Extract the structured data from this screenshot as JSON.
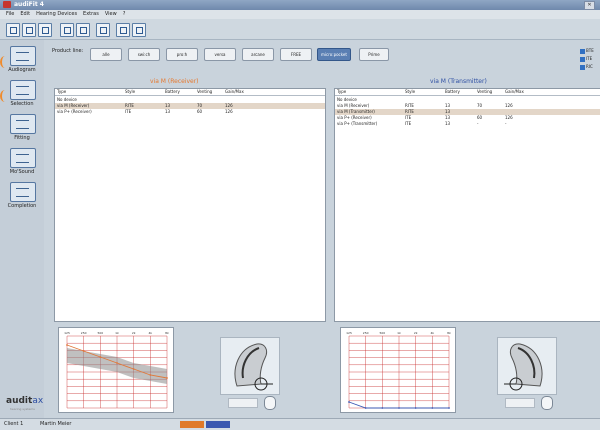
{
  "titlebar": {
    "title": "audiFit 4"
  },
  "menu": [
    "File",
    "Edit",
    "Hearing Devices",
    "Extras",
    "View",
    "?"
  ],
  "toolbar": {
    "icons": [
      "open-icon",
      "back-icon",
      "forward-icon",
      "audiogram-icon",
      "print-icon",
      "help-icon",
      "nav-left-icon",
      "nav-right-icon"
    ]
  },
  "sidebar": {
    "items": [
      {
        "label": "Audiogram",
        "icon": "audiogram-icon"
      },
      {
        "label": "Selection",
        "icon": "selection-icon"
      },
      {
        "label": "Fitting",
        "icon": "fitting-icon"
      },
      {
        "label": "Mo'Sound",
        "icon": "mosound-icon"
      },
      {
        "label": "Completion",
        "icon": "completion-icon"
      }
    ],
    "logo": {
      "brand": "audit",
      "accent": "ax",
      "sub": "hearing systems"
    }
  },
  "product_line": {
    "label": "Product line:",
    "tabs": [
      "alle",
      "swi:ch",
      "pro:h",
      "versa",
      "arcane",
      "FREE",
      "micro:pocket",
      "Prime"
    ],
    "active": "micro:pocket"
  },
  "checkboxes": [
    "BTE",
    "ITE",
    "RIC"
  ],
  "left_panel": {
    "title": "via M (Receiver)",
    "title_color": "#e6782e",
    "columns": [
      "Type",
      "Style",
      "Battery",
      "Venting",
      "Gain/Max"
    ],
    "rows": [
      {
        "cells": [
          "No device",
          "",
          "",
          "",
          ""
        ],
        "selected": false
      },
      {
        "cells": [
          "via M (Receiver)",
          "RITE",
          "13",
          "70",
          "126"
        ],
        "selected": true
      },
      {
        "cells": [
          "via P+ (Receiver)",
          "ITE",
          "13",
          "60",
          "126"
        ],
        "selected": false
      }
    ]
  },
  "right_panel": {
    "title": "via M (Transmitter)",
    "title_color": "#2e4fa3",
    "columns": [
      "Type",
      "Style",
      "Battery",
      "Venting",
      "Gain/Max"
    ],
    "rows": [
      {
        "cells": [
          "No device",
          "",
          "",
          "",
          ""
        ],
        "selected": false
      },
      {
        "cells": [
          "via M (Receiver)",
          "RITE",
          "13",
          "70",
          "126"
        ],
        "selected": false
      },
      {
        "cells": [
          "via M (Transmitter)",
          "RITE",
          "13",
          "",
          ""
        ],
        "selected": true
      },
      {
        "cells": [
          "via P+ (Receiver)",
          "ITE",
          "13",
          "60",
          "126"
        ],
        "selected": false
      },
      {
        "cells": [
          "via P+ (Transmitter)",
          "ITE",
          "13",
          "-",
          "-"
        ],
        "selected": false
      }
    ]
  },
  "chart_data": [
    {
      "type": "line",
      "x": [
        125,
        250,
        500,
        1000,
        2000,
        4000,
        8000
      ],
      "xlabels": [
        "125",
        "250",
        "500",
        "1k",
        "2k",
        "4k",
        "8k"
      ],
      "series": [
        {
          "values": [
            15,
            25,
            35,
            45,
            55,
            65,
            70
          ]
        }
      ],
      "band_low": [
        20,
        25,
        30,
        35,
        45,
        50,
        55
      ],
      "band_high": [
        45,
        50,
        55,
        60,
        70,
        75,
        80
      ],
      "color": "#e0783a",
      "grid": true
    },
    {
      "type": "line",
      "x": [
        125,
        250,
        500,
        1000,
        2000,
        4000,
        8000
      ],
      "xlabels": [
        "125",
        "250",
        "500",
        "1k",
        "2k",
        "4k",
        "8k"
      ],
      "series": [
        {
          "values": [
            110,
            120,
            120,
            120,
            120,
            120,
            120
          ]
        }
      ],
      "color": "#3b58b3",
      "grid": true
    }
  ],
  "statusbar": {
    "left": "Client 1",
    "middle": "Martin Meier"
  }
}
